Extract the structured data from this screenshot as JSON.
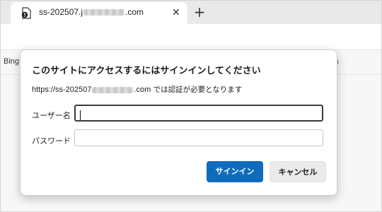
{
  "browser": {
    "tab": {
      "title_prefix": "ss-202507.j",
      "title_suffix": ".com",
      "close_label": "✕"
    },
    "new_tab_label": "+",
    "favorites": {
      "first_item": "Bing",
      "right_fragment": ")"
    }
  },
  "dialog": {
    "title": "このサイトにアクセスするにはサインインしてください",
    "description_url_prefix": "https://ss-202507",
    "description_url_suffix": ".com",
    "description_text": " では認証が必要となります",
    "username_label": "ユーザー名",
    "username_value": "",
    "password_label": "パスワード",
    "password_value": "",
    "signin_button": "サインイン",
    "cancel_button": "キャンセル"
  },
  "colors": {
    "primary_button": "#0f6cbd",
    "secondary_button": "#ebebeb",
    "tabstrip": "#e9e9e9"
  },
  "icons": [
    "page-icon",
    "close-icon",
    "plus-icon"
  ]
}
